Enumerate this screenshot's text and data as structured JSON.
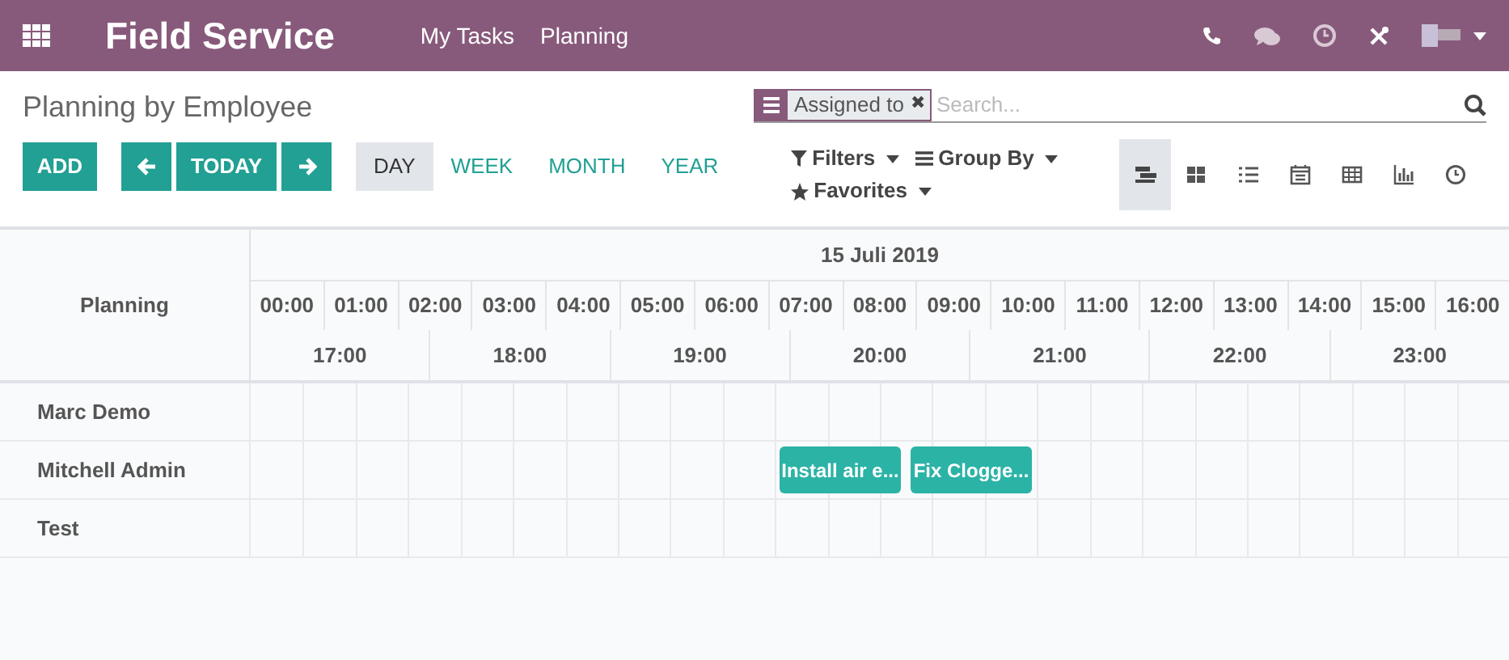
{
  "app_title": "Field Service",
  "menu": [
    {
      "label": "My Tasks"
    },
    {
      "label": "Planning"
    }
  ],
  "systray": [
    {
      "kind": "phone"
    },
    {
      "kind": "chat"
    },
    {
      "kind": "clock"
    },
    {
      "kind": "tools"
    },
    {
      "kind": "avatar"
    }
  ],
  "breadcrumb": "Planning by Employee",
  "search": {
    "facet": "Assigned to",
    "facet_remove": "✖",
    "placeholder": "Search..."
  },
  "buttons": {
    "add": "ADD",
    "today": "TODAY"
  },
  "scales": [
    {
      "label": "DAY",
      "selected": true
    },
    {
      "label": "WEEK",
      "selected": false
    },
    {
      "label": "MONTH",
      "selected": false
    },
    {
      "label": "YEAR",
      "selected": false
    }
  ],
  "search_options": [
    {
      "kind": "filter",
      "label": "Filters"
    },
    {
      "kind": "groupby",
      "label": "Group By"
    },
    {
      "kind": "favorite",
      "label": "Favorites"
    }
  ],
  "views": [
    {
      "kind": "gantt",
      "selected": true
    },
    {
      "kind": "kanban",
      "selected": false
    },
    {
      "kind": "list",
      "selected": false
    },
    {
      "kind": "calendar",
      "selected": false
    },
    {
      "kind": "pivot",
      "selected": false
    },
    {
      "kind": "graph",
      "selected": false
    },
    {
      "kind": "activity",
      "selected": false
    }
  ],
  "gantt": {
    "title": "Planning",
    "date": "15 Juli 2019",
    "hours_row_1": [
      "00:00",
      "01:00",
      "02:00",
      "03:00",
      "04:00",
      "05:00",
      "06:00",
      "07:00",
      "08:00",
      "09:00",
      "10:00",
      "11:00",
      "12:00",
      "13:00",
      "14:00",
      "15:00",
      "16:00"
    ],
    "hours_row_2": [
      "17:00",
      "18:00",
      "19:00",
      "20:00",
      "21:00",
      "22:00",
      "23:00"
    ],
    "rows": [
      {
        "name": "Marc Demo",
        "tasks": []
      },
      {
        "name": "Mitchell Admin",
        "tasks": [
          {
            "label": "Install air e..."
          },
          {
            "label": "Fix Clogge..."
          }
        ]
      },
      {
        "name": "Test",
        "tasks": []
      }
    ]
  }
}
